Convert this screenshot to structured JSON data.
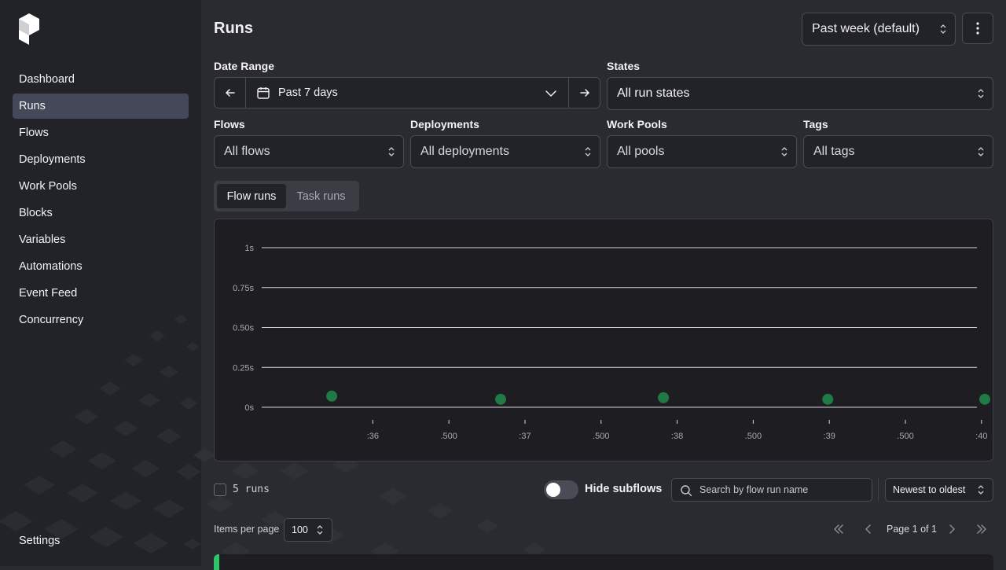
{
  "sidebar": {
    "items": [
      {
        "label": "Dashboard",
        "active": false
      },
      {
        "label": "Runs",
        "active": true
      },
      {
        "label": "Flows",
        "active": false
      },
      {
        "label": "Deployments",
        "active": false
      },
      {
        "label": "Work Pools",
        "active": false
      },
      {
        "label": "Blocks",
        "active": false
      },
      {
        "label": "Variables",
        "active": false
      },
      {
        "label": "Automations",
        "active": false
      },
      {
        "label": "Event Feed",
        "active": false
      },
      {
        "label": "Concurrency",
        "active": false
      }
    ],
    "settings_label": "Settings"
  },
  "header": {
    "title": "Runs",
    "range_select": "Past week (default)"
  },
  "filters": {
    "date_range_label": "Date Range",
    "date_range_value": "Past 7 days",
    "states_label": "States",
    "states_value": "All run states",
    "flows_label": "Flows",
    "flows_value": "All flows",
    "deployments_label": "Deployments",
    "deployments_value": "All deployments",
    "work_pools_label": "Work Pools",
    "work_pools_value": "All pools",
    "tags_label": "Tags",
    "tags_value": "All tags"
  },
  "tabs": [
    {
      "label": "Flow runs",
      "active": true
    },
    {
      "label": "Task runs",
      "active": false
    }
  ],
  "chart_data": {
    "type": "scatter",
    "y_ticks": [
      "1s",
      "0.75s",
      "0.50s",
      "0.25s",
      "0s"
    ],
    "y_values": [
      1,
      0.75,
      0.5,
      0.25,
      0
    ],
    "ylim": [
      0,
      1
    ],
    "x_ticks": [
      ":36",
      ".500",
      ":37",
      ".500",
      ":38",
      ".500",
      ":39",
      ".500",
      ":40"
    ],
    "x_tick_values": [
      36,
      36.5,
      37,
      37.5,
      38,
      38.5,
      39,
      39.5,
      40
    ],
    "xlim": [
      35.27,
      39.97
    ],
    "points": [
      {
        "x": 35.73,
        "y": 0.07
      },
      {
        "x": 36.84,
        "y": 0.05
      },
      {
        "x": 37.91,
        "y": 0.06
      },
      {
        "x": 38.99,
        "y": 0.05
      },
      {
        "x": 40.08,
        "y": 0.05
      }
    ],
    "point_color": "#1f7a45",
    "grid": true
  },
  "footer": {
    "runs_count": "5 runs",
    "hide_subflows_label": "Hide subflows",
    "search_placeholder": "Search by flow run name",
    "sort_value": "Newest to oldest",
    "items_per_page_label": "Items per page",
    "items_per_page_value": "100",
    "page_info": "Page 1 of 1"
  },
  "colors": {
    "accent": "#2ec46a",
    "active_nav": "#454858"
  }
}
